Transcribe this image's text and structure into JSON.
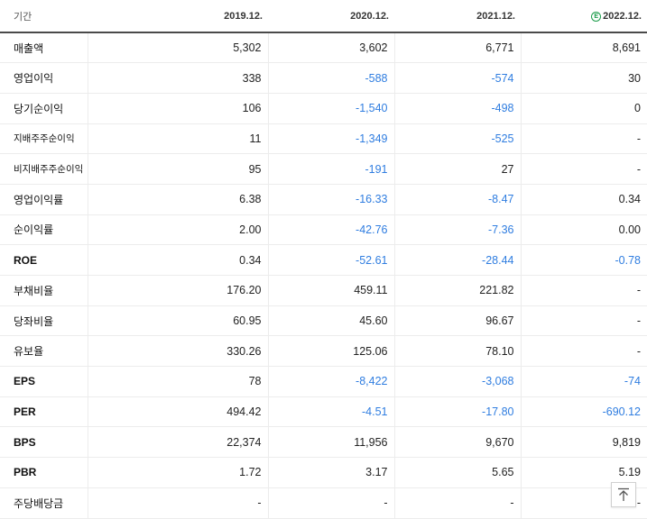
{
  "header": {
    "period_label": "기간",
    "periods": [
      "2019.12.",
      "2020.12.",
      "2021.12.",
      "2022.12."
    ],
    "estimate_icon": "estimate-e-icon",
    "estimate_color": "#1a9c4a"
  },
  "rows": [
    {
      "label": "매출액",
      "values": [
        "5,302",
        "3,602",
        "6,771",
        "8,691"
      ]
    },
    {
      "label": "영업이익",
      "values": [
        "338",
        "-588",
        "-574",
        "30"
      ]
    },
    {
      "label": "당기순이익",
      "values": [
        "106",
        "-1,540",
        "-498",
        "0"
      ]
    },
    {
      "label": "지배주주순이익",
      "values": [
        "11",
        "-1,349",
        "-525",
        "-"
      ]
    },
    {
      "label": "비지배주주순이익",
      "values": [
        "95",
        "-191",
        "27",
        "-"
      ]
    },
    {
      "label": "영업이익률",
      "values": [
        "6.38",
        "-16.33",
        "-8.47",
        "0.34"
      ]
    },
    {
      "label": "순이익률",
      "values": [
        "2.00",
        "-42.76",
        "-7.36",
        "0.00"
      ]
    },
    {
      "label": "ROE",
      "values": [
        "0.34",
        "-52.61",
        "-28.44",
        "-0.78"
      ]
    },
    {
      "label": "부채비율",
      "values": [
        "176.20",
        "459.11",
        "221.82",
        "-"
      ]
    },
    {
      "label": "당좌비율",
      "values": [
        "60.95",
        "45.60",
        "96.67",
        "-"
      ]
    },
    {
      "label": "유보율",
      "values": [
        "330.26",
        "125.06",
        "78.10",
        "-"
      ]
    },
    {
      "label": "EPS",
      "values": [
        "78",
        "-8,422",
        "-3,068",
        "-74"
      ]
    },
    {
      "label": "PER",
      "values": [
        "494.42",
        "-4.51",
        "-17.80",
        "-690.12"
      ]
    },
    {
      "label": "BPS",
      "values": [
        "22,374",
        "11,956",
        "9,670",
        "9,819"
      ]
    },
    {
      "label": "PBR",
      "values": [
        "1.72",
        "3.17",
        "5.65",
        "5.19"
      ]
    },
    {
      "label": "주당배당금",
      "values": [
        "-",
        "-",
        "-",
        "-"
      ]
    }
  ],
  "colors": {
    "negative": "#2f7de0",
    "text": "#222222"
  },
  "scroll_top_icon": "arrow-up-to-top-icon"
}
